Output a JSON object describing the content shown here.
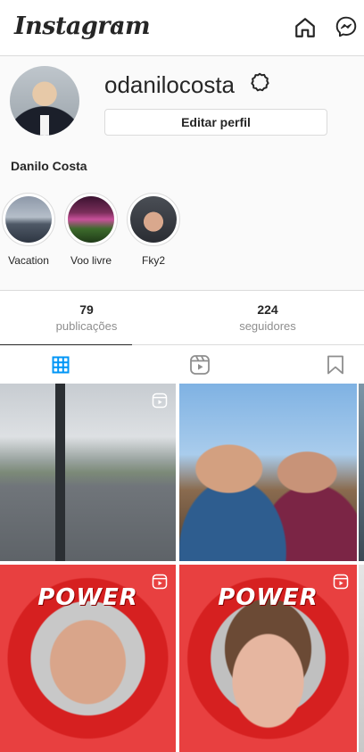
{
  "header": {
    "logo_text": "Instagram",
    "icons": [
      "chevron-down-icon",
      "home-icon",
      "messenger-icon"
    ]
  },
  "profile": {
    "username": "odanilocosta",
    "edit_button_label": "Editar perfil",
    "full_name": "Danilo Costa"
  },
  "highlights": [
    {
      "label": "Vacation"
    },
    {
      "label": "Voo livre"
    },
    {
      "label": "Fky2"
    }
  ],
  "stats": [
    {
      "value": "79",
      "label": "publicações"
    },
    {
      "value": "224",
      "label": "seguidores"
    }
  ],
  "tabs": [
    {
      "icon": "grid-icon",
      "active": true
    },
    {
      "icon": "reels-icon",
      "active": false
    },
    {
      "icon": "saved-icon",
      "active": false
    }
  ],
  "grid": {
    "power_text_1": "POWER",
    "power_text_2": "POWER"
  },
  "colors": {
    "active_blue": "#0095f6",
    "text": "#262626",
    "muted": "#8e8e8e",
    "border": "#dbdbdb"
  }
}
